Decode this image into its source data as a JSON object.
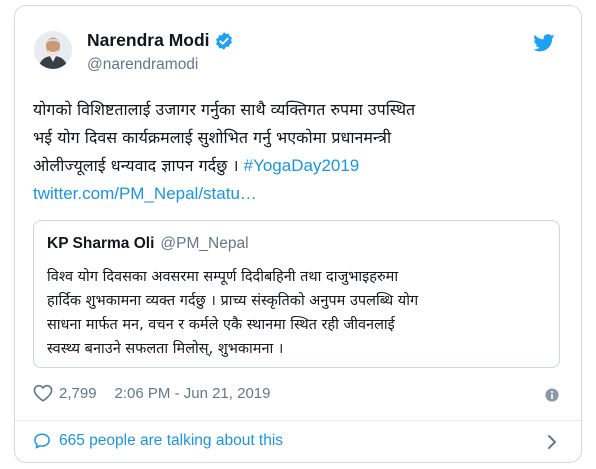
{
  "author": {
    "name": "Narendra Modi",
    "handle": "@narendramodi",
    "verified_icon": "verified-badge-icon",
    "avatar": "avatar"
  },
  "brand_icon": "twitter-bird-icon",
  "tweet": {
    "lines": [
      "योगको विशिष्टतालाई उजागर गर्नुका साथै व्यक्तिगत रुपमा उपस्थित",
      "भई योग दिवस कार्यक्रमलाई सुशोभित गर्नु भएकोमा प्रधानमन्त्री",
      "ओलीज्यूलाई धन्यवाद ज्ञापन गर्दछु ।"
    ],
    "hashtag": "#YogaDay2019",
    "link": "twitter.com/PM_Nepal/statu…"
  },
  "quoted_tweet": {
    "name": "KP Sharma Oli",
    "handle": "@PM_Nepal",
    "lines": [
      "विश्व योग दिवसका अवसरमा सम्पूर्ण दिदीबहिनी तथा दाजुभाइहरुमा",
      "हार्दिक शुभकामना व्यक्त गर्दछु । प्राच्य संस्कृतिको अनुपम उपलब्धि योग",
      "साधना मार्फत मन, वचन र कर्मले एकै स्थानमा स्थित रही जीवनलाई",
      "स्वस्थ्य बनाउने सफलता मिलोस्, शुभकामना ।"
    ]
  },
  "meta": {
    "likes": "2,799",
    "timestamp": "2:06 PM - Jun 21, 2019",
    "heart_icon": "heart-icon",
    "info_icon": "info-icon"
  },
  "footer": {
    "text": "665 people are talking about this",
    "icon": "speech-bubble-icon",
    "chevron": "chevron-right-icon"
  },
  "colors": {
    "link": "#1b95e0",
    "muted": "#657786",
    "border": "#d4dbe0",
    "verified": "#1da1f2"
  }
}
